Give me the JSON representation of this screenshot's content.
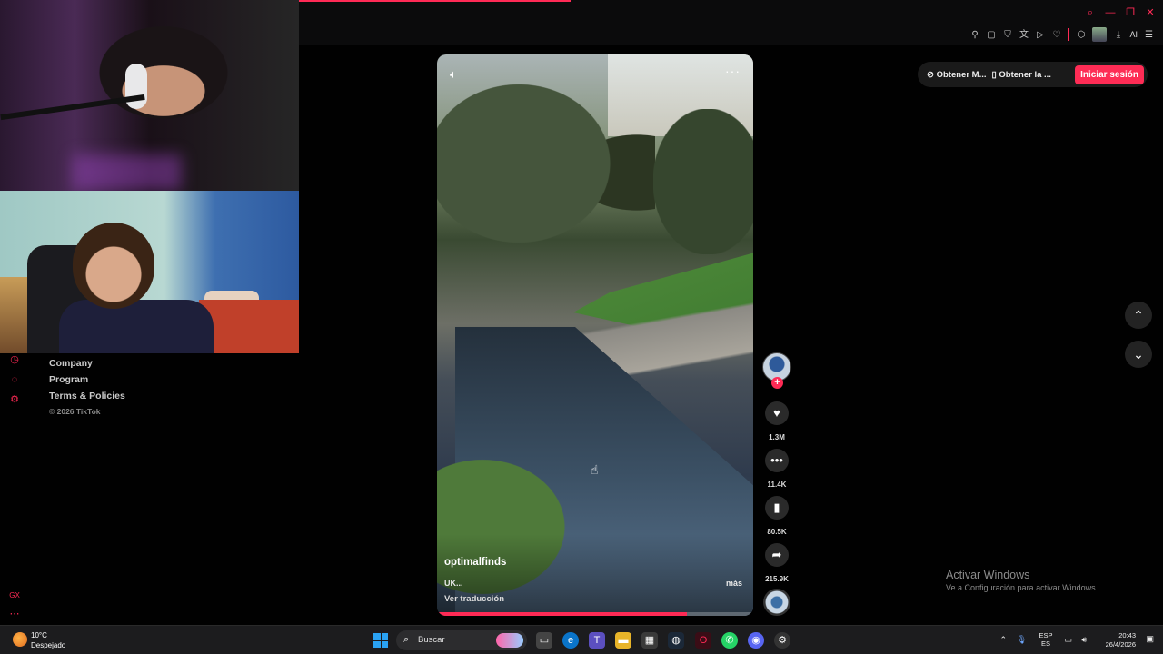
{
  "browser": {
    "window_controls": [
      "search-icon",
      "minimize-icon",
      "restore-icon",
      "close-icon"
    ],
    "extensions_ai_label": "AI"
  },
  "header": {
    "get_app_label": "Obtener M...",
    "get_desktop_label": "Obtener la ...",
    "login_label": "Iniciar sesión",
    "accent_color": "#fe2c55"
  },
  "footer_links": {
    "company": "Company",
    "program": "Program",
    "terms": "Terms & Policies",
    "copyright": "© 2026 TikTok"
  },
  "video": {
    "author": "optimalfinds",
    "caption": "UK...",
    "more_label": "más",
    "translate_label": "Ver traducción",
    "progress": 0.79
  },
  "actions": {
    "likes": "1.3M",
    "comments": "11.4K",
    "saves": "80.5K",
    "shares": "215.9K",
    "follow_symbol": "+"
  },
  "watermark": {
    "title": "Activar Windows",
    "subtitle": "Ve a Configuración para activar Windows."
  },
  "taskbar": {
    "weather_temp": "10°C",
    "weather_desc": "Despejado",
    "search_placeholder": "Buscar",
    "lang_top": "ESP",
    "lang_bottom": "ES",
    "time": "20:43",
    "date": "26/4/2026"
  }
}
